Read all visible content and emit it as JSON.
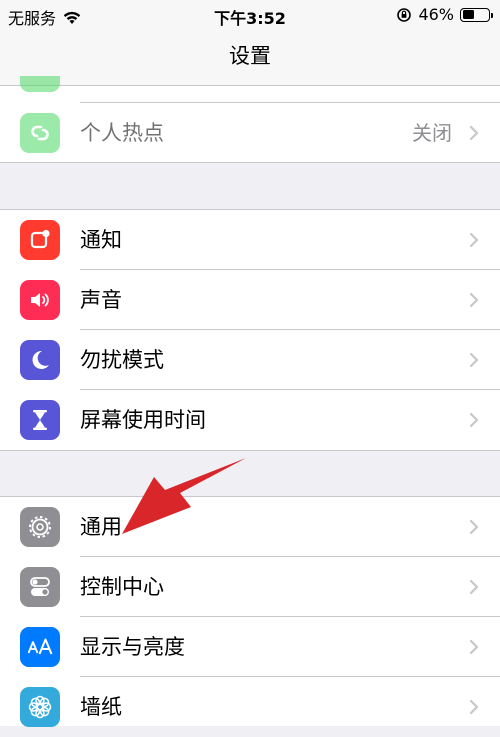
{
  "status_bar": {
    "carrier": "无服务",
    "time": "下午3:52",
    "battery_percent": "46%",
    "battery_level": 0.46
  },
  "nav": {
    "title": "设置"
  },
  "rows": {
    "hotspot": {
      "label": "个人热点",
      "detail": "关闭",
      "icon": "hotspot-icon"
    },
    "notifications": {
      "label": "通知",
      "icon": "notifications-icon"
    },
    "sounds": {
      "label": "声音",
      "icon": "speaker-icon"
    },
    "dnd": {
      "label": "勿扰模式",
      "icon": "moon-icon"
    },
    "screen_time": {
      "label": "屏幕使用时间",
      "icon": "hourglass-icon"
    },
    "general": {
      "label": "通用",
      "icon": "gear-icon"
    },
    "control_center": {
      "label": "控制中心",
      "icon": "toggles-icon"
    },
    "display": {
      "label": "显示与亮度",
      "icon": "text-size-icon"
    },
    "wallpaper": {
      "label": "墙纸",
      "icon": "flower-icon"
    }
  },
  "colors": {
    "hotspot": "#4cd964",
    "notifications": "#ff3b30",
    "sounds": "#ff2d55",
    "dnd": "#5856d6",
    "screen_time": "#5856d6",
    "general": "#8e8e93",
    "control_center": "#8e8e93",
    "display": "#007aff",
    "wallpaper": "#34aadc",
    "annotation_arrow": "#d8262b"
  }
}
